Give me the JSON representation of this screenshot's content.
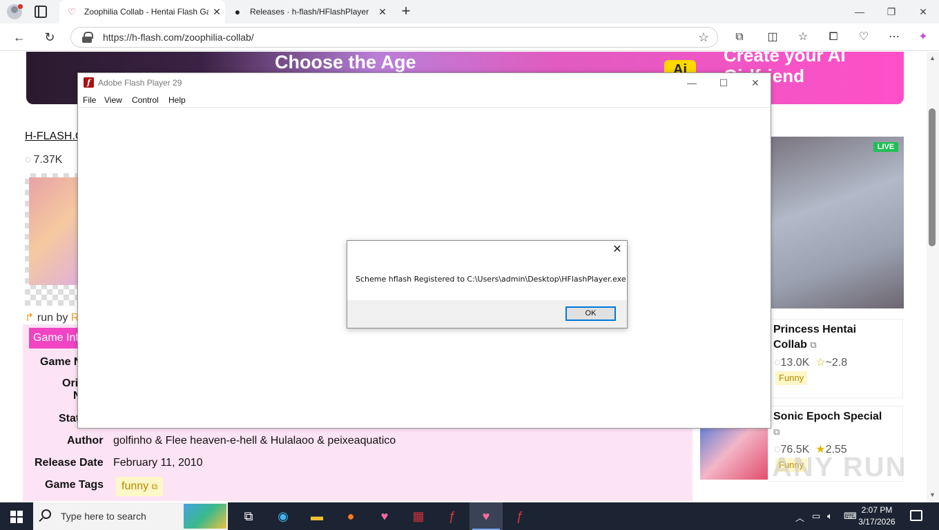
{
  "browser": {
    "tabs": [
      {
        "title": "Zoophilia Collab - Hentai Flash Ga",
        "active": true
      },
      {
        "title": "Releases · h-flash/HFlashPlayer",
        "active": false
      }
    ],
    "url": "https://h-flash.com/zoophilia-collab/"
  },
  "page": {
    "banner": {
      "left_text": "Choose the Age",
      "badge": "Ai",
      "right_text": "Create your AI Girlfriend"
    },
    "breadcrumb": "H-FLASH.C",
    "views": "7.37K",
    "run_by_prefix": "run by",
    "run_by_name": "R",
    "game_info_button": "Game Inf",
    "fields": {
      "game_name_label": "Game N",
      "original_label_1": "Ori",
      "original_label_2": "N",
      "status_label": "Stat",
      "author_label": "Author",
      "author_value": "golfinho & Flee heaven-e-hell & Hulalaoo & peixeaquatico",
      "release_label": "Release Date",
      "release_value": "February 11, 2010",
      "tags_label": "Game Tags",
      "tag_value": "funny"
    },
    "sidebar": {
      "live_badge": "LIVE",
      "cards": [
        {
          "title_1": "Princess Hentai",
          "title_2": "Collab",
          "views": "13.0K",
          "rating": "~2.8",
          "tag": "Funny"
        },
        {
          "title_1": "Sonic Epoch Special",
          "views": "76.5K",
          "rating": "2.55",
          "tag": "Funny"
        }
      ]
    },
    "watermark": "ANY RUN"
  },
  "flash_window": {
    "title": "Adobe Flash Player 29",
    "menu": [
      "File",
      "View",
      "Control",
      "Help"
    ]
  },
  "dialog": {
    "message": "Scheme hflash Registered to C:\\Users\\admin\\Desktop\\HFlashPlayer.exe",
    "ok_label": "OK"
  },
  "taskbar": {
    "search_placeholder": "Type here to search",
    "time": "2:07 PM",
    "date": "3/17/2026"
  }
}
